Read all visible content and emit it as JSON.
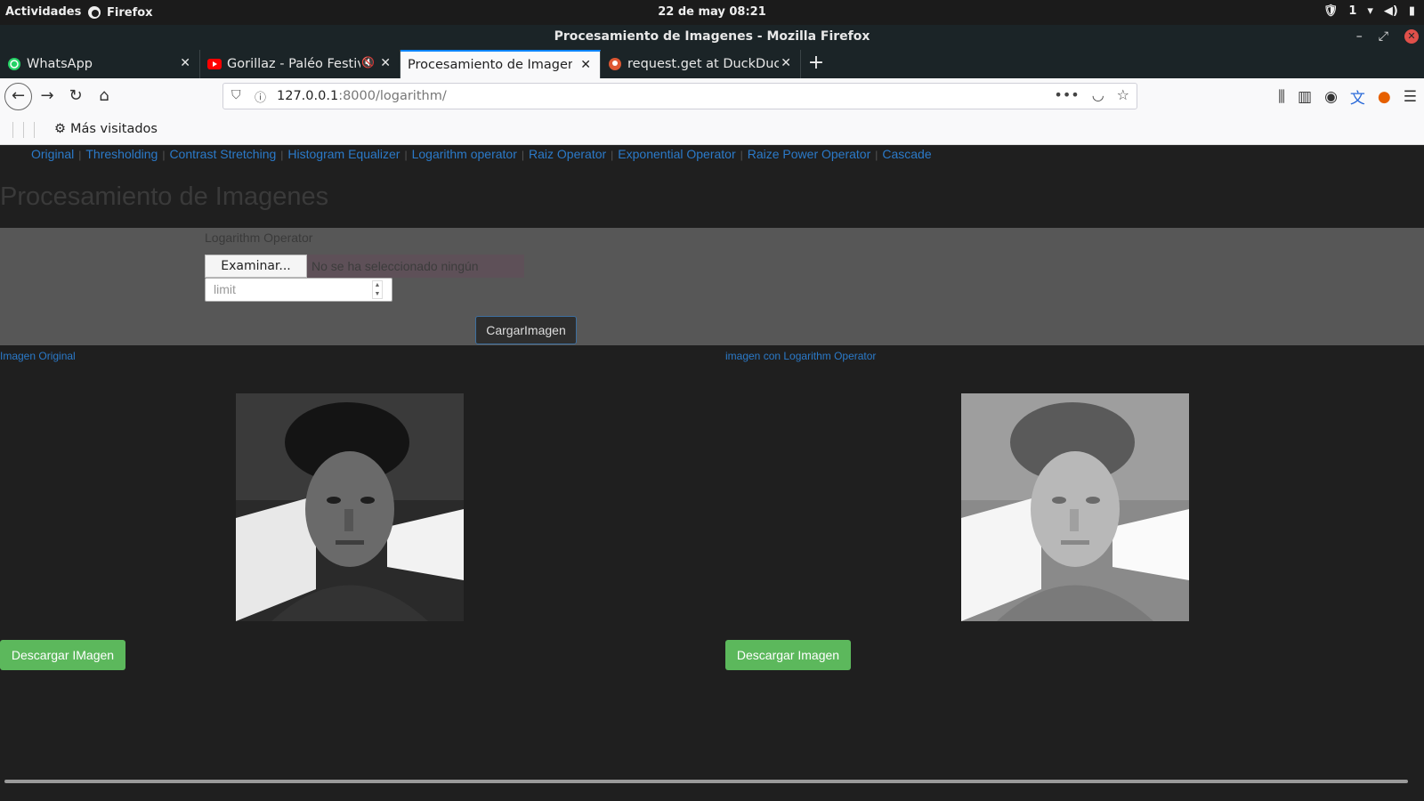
{
  "gnome": {
    "activities": "Actividades",
    "app_name": "Firefox",
    "clock": "22 de may  08:21",
    "tray_count": "1"
  },
  "window": {
    "title": "Procesamiento de Imagenes - Mozilla Firefox"
  },
  "tabs": [
    {
      "label": "WhatsApp",
      "icon": "whatsapp-icon"
    },
    {
      "label": "Gorillaz - Paléo Festival",
      "icon": "youtube-icon"
    },
    {
      "label": "Procesamiento de Imagenes",
      "icon": "none"
    },
    {
      "label": "request.get at DuckDuckGo",
      "icon": "duckduckgo-icon"
    }
  ],
  "urlbar": {
    "host": "127.0.0.1",
    "path": ":8000/logarithm/"
  },
  "bookmarks": {
    "most_visited": "Más visitados"
  },
  "nav": {
    "items": [
      "Original",
      "Thresholding",
      "Contrast Stretching",
      "Histogram Equalizer",
      "Logarithm operator",
      "Raiz Operator",
      "Exponential Operator",
      "Raize Power Operator",
      "Cascade"
    ]
  },
  "page": {
    "title": "Procesamiento de Imagenes",
    "form_label": "Logarithm Operator",
    "file_button": "Examinar...",
    "file_status": "No se ha seleccionado ningún archivo.",
    "limit_placeholder": "limit",
    "submit": "CargarImagen",
    "original_label": "Imagen Original",
    "result_label": "imagen con Logarithm Operator",
    "download_left": "Descargar IMagen",
    "download_right": "Descargar Imagen"
  },
  "colors": {
    "link": "#2b7ac9",
    "download": "#5cb85c",
    "accent": "#0a84ff"
  }
}
